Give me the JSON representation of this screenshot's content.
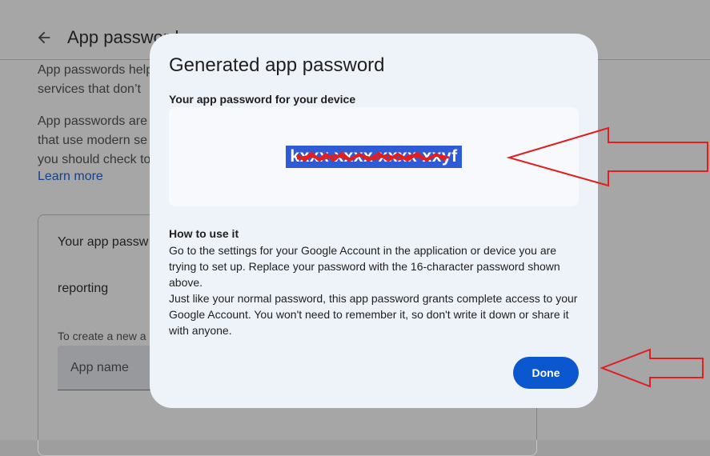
{
  "header": {
    "title": "App passwords"
  },
  "background": {
    "intro_line1": "App passwords help",
    "intro_line2": "services that don’t",
    "para_line1": "App passwords are",
    "para_line2": "that use modern se",
    "para_line3": "you should check to",
    "learn_more": "Learn more",
    "card_title": "Your app passw",
    "card_item": "reporting",
    "create_hint": "To create a new a",
    "input_placeholder": "App name"
  },
  "dialog": {
    "title": "Generated app password",
    "subtitle": "Your app password for your device",
    "password": "kxxx xxxx xxxx xxyf",
    "howto_heading": "How to use it",
    "howto_p1": "Go to the settings for your Google Account in the application or device you are trying to set up. Replace your password with the 16-character password shown above.",
    "howto_p2": "Just like your normal password, this app password grants complete access to your Google Account. You won't need to remember it, so don't write it down or share it with anyone.",
    "done_label": "Done"
  },
  "colors": {
    "accent": "#0b57d0",
    "annotation": "#e02020",
    "dialog_bg": "#eef2f9",
    "password_highlight": "#2f5bd6"
  },
  "icons": {
    "back": "arrow-back-icon"
  }
}
